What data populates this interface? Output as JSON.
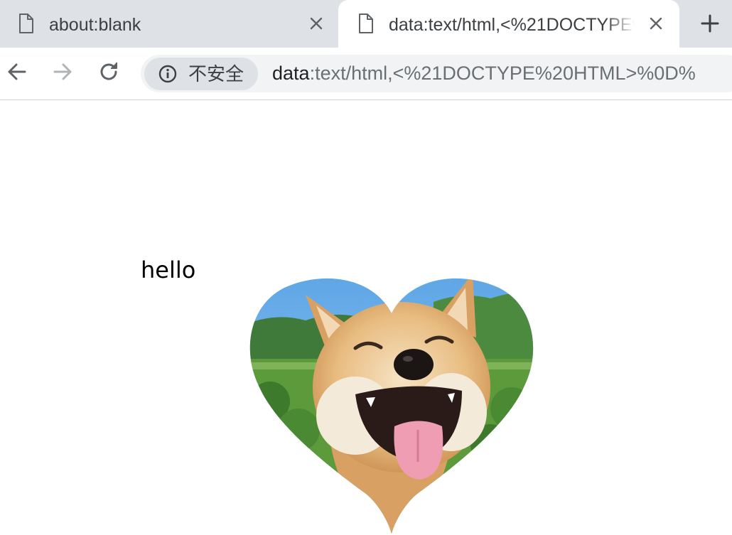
{
  "tabs": [
    {
      "title": "about:blank",
      "active": false,
      "icon": "document-icon"
    },
    {
      "title": "data:text/html,<%21DOCTYPE%20HTML>%0D%",
      "active": true,
      "icon": "document-icon"
    }
  ],
  "toolbar": {
    "security_label": "不安全",
    "url_scheme": "data",
    "url_rest": ":text/html,<%21DOCTYPE%20HTML>%0D%"
  },
  "page": {
    "text": "hello",
    "image": "heart-shaped-shiba-inu-photo"
  },
  "colors": {
    "tabstrip_bg": "#dee1e6",
    "omnibox_bg": "#f1f3f4",
    "chip_bg": "#dee1e6",
    "icon_color": "#5f6368",
    "disabled_icon_color": "#b0b3b8"
  }
}
